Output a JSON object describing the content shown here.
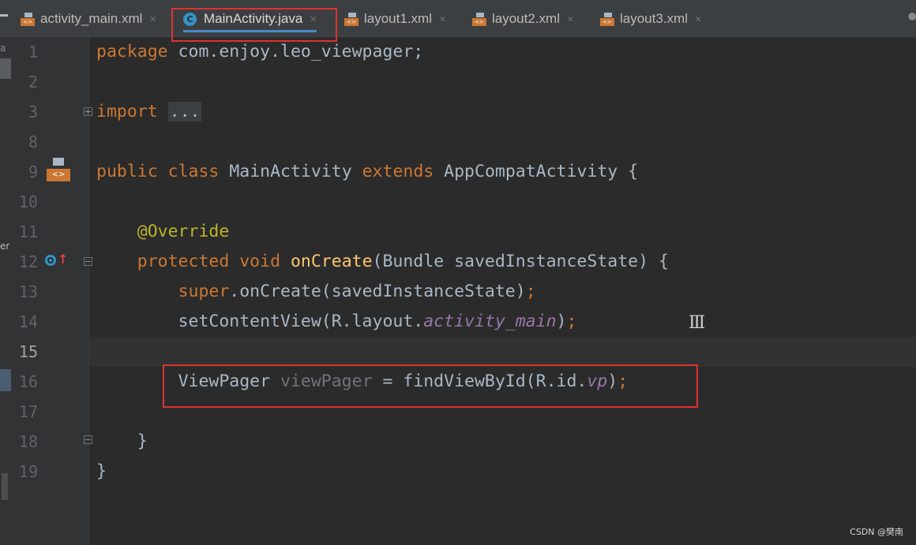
{
  "tabs": [
    {
      "label": "activity_main.xml",
      "icon": "xml-layout-icon",
      "active": false
    },
    {
      "label": "MainActivity.java",
      "icon": "java-class-icon",
      "active": true
    },
    {
      "label": "layout1.xml",
      "icon": "xml-layout-icon",
      "active": false
    },
    {
      "label": "layout2.xml",
      "icon": "xml-layout-icon",
      "active": false
    },
    {
      "label": "layout3.xml",
      "icon": "xml-layout-icon",
      "active": false
    }
  ],
  "close_glyph": "×",
  "xml_icon_text": "<>",
  "gutter": {
    "line_numbers": [
      "1",
      "2",
      "3",
      "8",
      "9",
      "10",
      "11",
      "12",
      "13",
      "14",
      "15",
      "16",
      "17",
      "18",
      "19"
    ],
    "current_line": "15"
  },
  "code": {
    "l1_kw": "package",
    "l1_rest": " com.enjoy.leo_viewpager;",
    "l3_kw": "import",
    "l3_fold": "...",
    "l9_kw1": "public",
    "l9_kw2": "class",
    "l9_name": "MainActivity",
    "l9_kw3": "extends",
    "l9_parent": "AppCompatActivity",
    "l9_brace": " {",
    "l11_ann": "@Override",
    "l12_kw1": "protected",
    "l12_kw2": "void",
    "l12_fn": "onCreate",
    "l12_rest": "(Bundle savedInstanceState) {",
    "l13_kw": "super",
    "l13_rest": ".onCreate(savedInstanceState)",
    "l13_semi": ";",
    "l14_a": "setContentView(R.layout.",
    "l14_it": "activity_main",
    "l14_b": ")",
    "l14_semi": ";",
    "l16_type": "ViewPager ",
    "l16_var": "viewPager",
    "l16_mid": " = findViewById(R.id.",
    "l16_it": "vp",
    "l16_end": ")",
    "l16_semi": ";",
    "l18": "}",
    "l19": "}"
  },
  "side_labels": {
    "a": "a",
    "er": "er"
  },
  "watermark": "CSDN @樊南",
  "colors": {
    "keyword": "#cc7832",
    "annotation": "#bbb529",
    "method": "#ffc66d",
    "field_italic": "#9876aa",
    "highlight_box": "#e03131"
  }
}
